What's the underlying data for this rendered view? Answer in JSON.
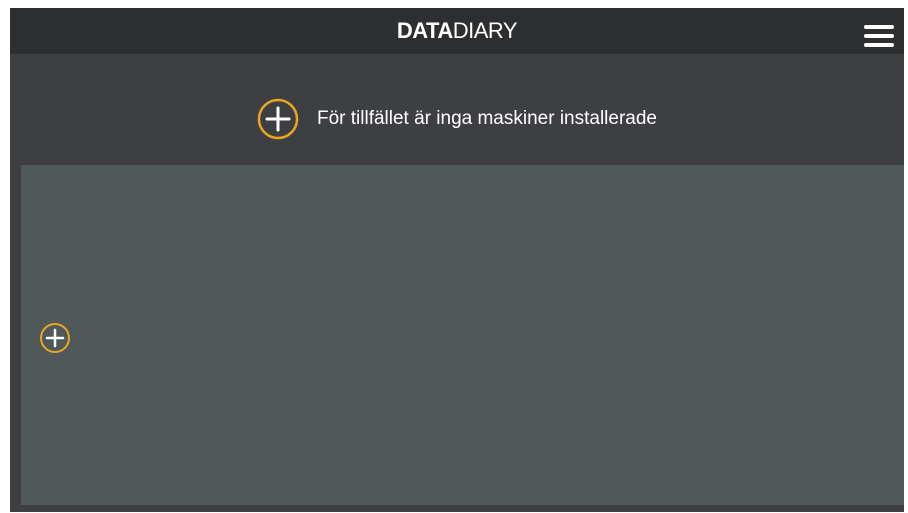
{
  "header": {
    "logo_bold": "DATA",
    "logo_light": "DIARY",
    "menu_icon": "hamburger-menu-icon"
  },
  "main": {
    "notice_text": "För tillfället är inga maskiner installerade",
    "add_icon": "plus-circle-icon"
  },
  "colors": {
    "header_bg": "#2d2e30",
    "page_bg": "#3e3f42",
    "panel_bg": "#50595a",
    "accent": "#e8a61f"
  }
}
